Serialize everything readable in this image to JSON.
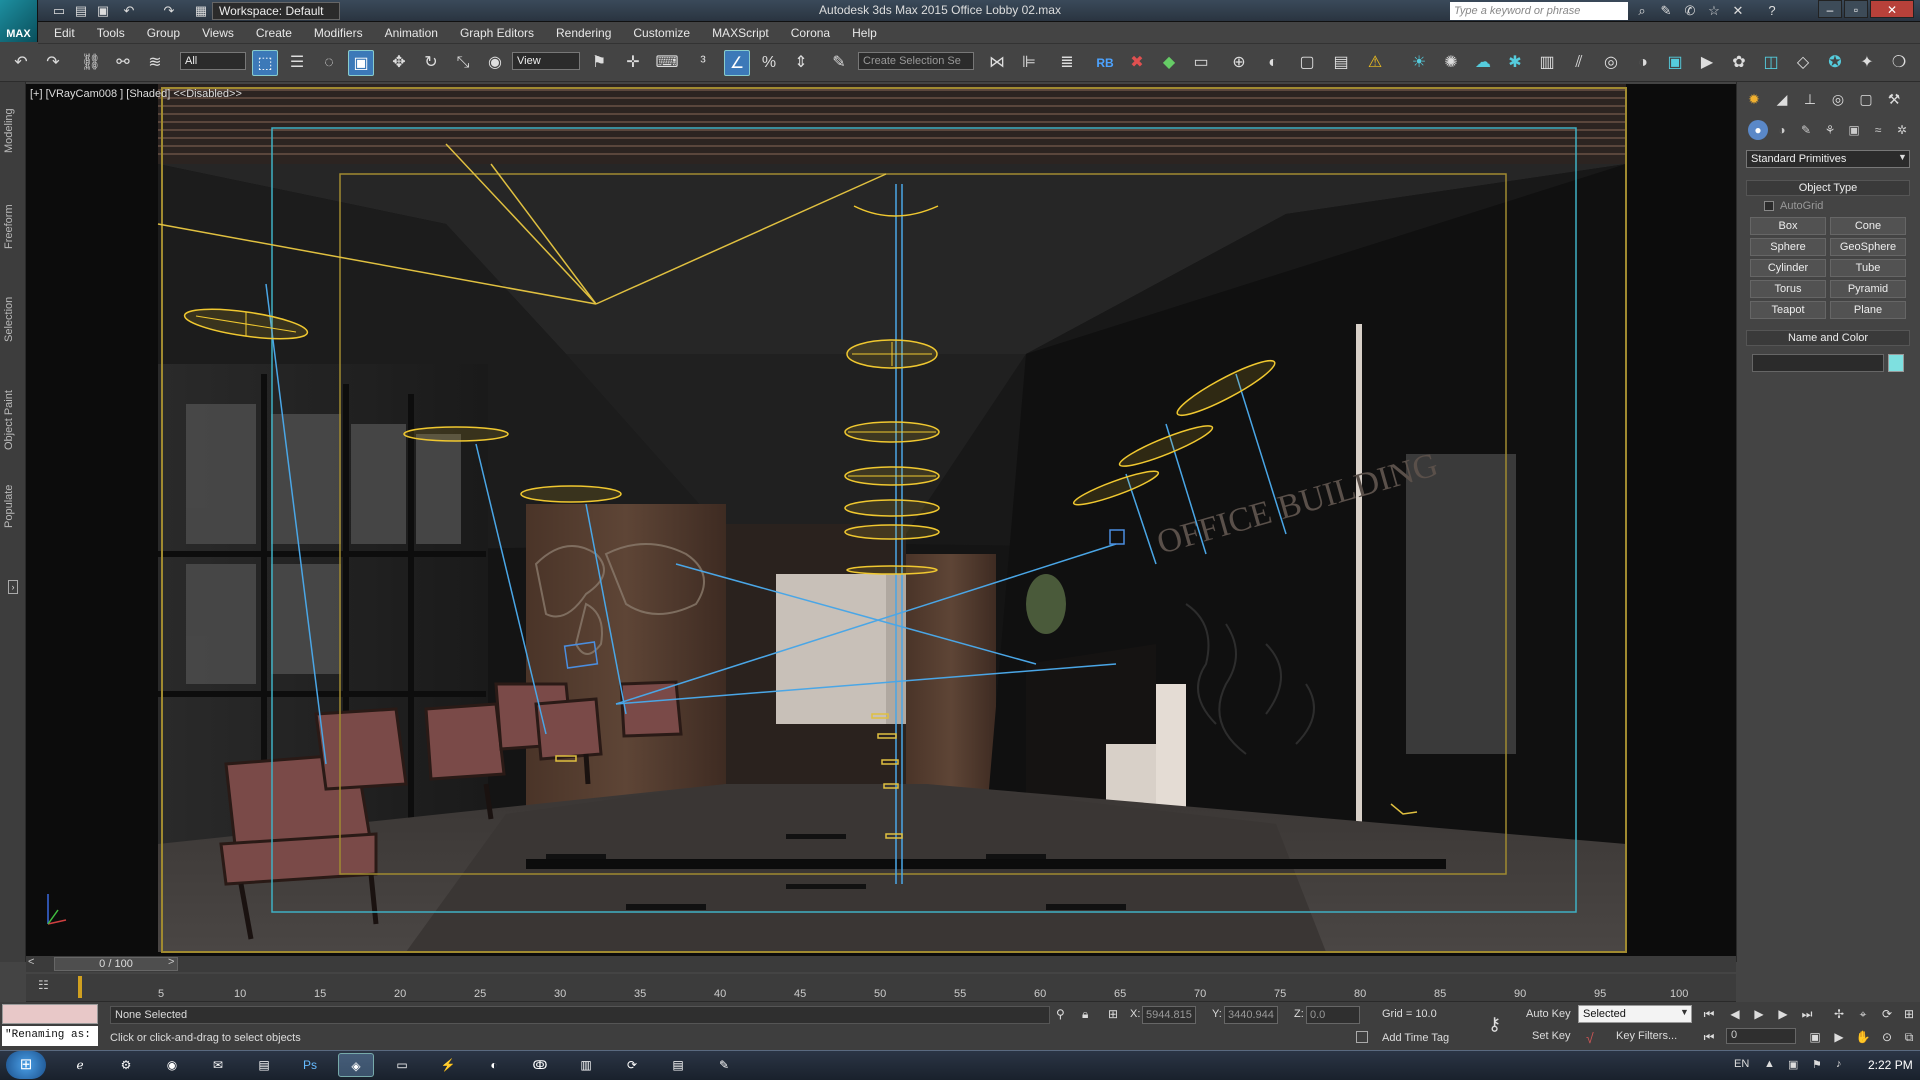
{
  "titlebar": {
    "workspace": "Workspace: Default",
    "title": "Autodesk 3ds Max 2015    Office Lobby 02.max",
    "search_placeholder": "Type a keyword or phrase",
    "logo_text": "MAX"
  },
  "menu": [
    "Edit",
    "Tools",
    "Group",
    "Views",
    "Create",
    "Modifiers",
    "Animation",
    "Graph Editors",
    "Rendering",
    "Customize",
    "MAXScript",
    "Corona",
    "Help"
  ],
  "toolbar": {
    "filter": "All",
    "ref_coord": "View",
    "named_selection_placeholder": "Create Selection Se"
  },
  "left_tabs": [
    "Modeling",
    "Freeform",
    "Selection",
    "Object Paint",
    "Populate"
  ],
  "viewport": {
    "label": "[+] [VRayCam008 ] [Shaded]  <<Disabled>>",
    "wall_text": "OFFICE BUILDING"
  },
  "command_panel": {
    "dropdown": "Standard Primitives",
    "object_type_title": "Object Type",
    "autogrid": "AutoGrid",
    "buttons": [
      "Box",
      "Cone",
      "Sphere",
      "GeoSphere",
      "Cylinder",
      "Tube",
      "Torus",
      "Pyramid",
      "Teapot",
      "Plane"
    ],
    "name_color_title": "Name and Color",
    "object_color": "#7ee0e0"
  },
  "timeline": {
    "slider": "0 / 100",
    "ticks": [
      "5",
      "10",
      "15",
      "20",
      "25",
      "30",
      "35",
      "40",
      "45",
      "50",
      "55",
      "60",
      "65",
      "70",
      "75",
      "80",
      "85",
      "90",
      "95",
      "100"
    ]
  },
  "status": {
    "selection": "None Selected",
    "prompt": "Click or click-and-drag to select objects",
    "maxscript_output": "\"Renaming as:",
    "x_label": "X:",
    "x": "5944.815",
    "y_label": "Y:",
    "y": "3440.944",
    "z_label": "Z:",
    "z": "0.0",
    "grid": "Grid = 10.0",
    "add_time_tag": "Add Time Tag",
    "auto_key": "Auto Key",
    "set_key": "Set Key",
    "key_mode": "Selected",
    "key_filters": "Key Filters...",
    "frame": "0"
  },
  "taskbar": {
    "lang": "EN",
    "time": "2:22 PM"
  }
}
